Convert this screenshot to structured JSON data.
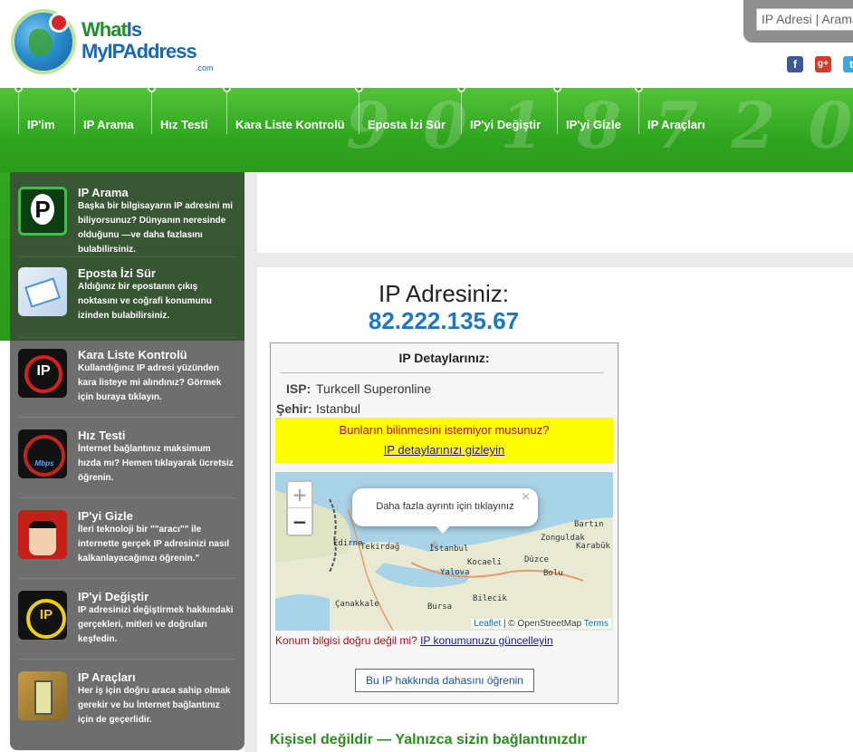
{
  "logo": {
    "line1_a": "What",
    "line1_b": "Is",
    "line2": "MyIPAddress",
    "tld": ".com"
  },
  "search": {
    "placeholder": "IP Adresi | Arama"
  },
  "social": {
    "facebook": "f",
    "googleplus": "g+",
    "twitter": "t"
  },
  "nav": {
    "items": [
      {
        "label": "IP'im"
      },
      {
        "label": "IP Arama"
      },
      {
        "label": "Hız Testi"
      },
      {
        "label": "Kara Liste Kontrolü"
      },
      {
        "label": "Eposta İzi Sür"
      },
      {
        "label": "IP'yi Değiştir"
      },
      {
        "label": "IP'yi Gizle"
      },
      {
        "label": "IP Araçları"
      }
    ]
  },
  "sidebar": {
    "items": [
      {
        "icon": "magnifier-ip-icon",
        "title": "IP Arama",
        "desc": "Başka bir bilgisayarın IP adresini mi biliyorsunuz? Dünyanın neresinde olduğunu —ve daha fazlasını bulabilirsiniz."
      },
      {
        "icon": "email-trace-icon",
        "title": "Eposta İzi Sür",
        "desc": "Aldığınız bir epostanın çıkış noktasını ve coğrafi konumunu izinden bulabilirsiniz."
      },
      {
        "icon": "blacklist-icon",
        "title": "Kara Liste Kontrolü",
        "desc": "Kullandığınız IP adresi yüzünden kara listeye mi alındınız? Görmek için buraya tıklayın."
      },
      {
        "icon": "speedometer-icon",
        "title": "Hız Testi",
        "desc": "İnternet bağlantınız maksimum hızda mı? Hemen tıklayarak ücretsiz öğrenin."
      },
      {
        "icon": "incognito-icon",
        "title": "IP'yi Gizle",
        "desc": "İleri teknoloji bir \"\"aracı\"\" ile internette gerçek IP adresinizi nasıl kalkanlayacağınızı öğrenin.\""
      },
      {
        "icon": "ip-change-icon",
        "title": "IP'yi Değiştir",
        "desc": "IP adresinizi değiştirmek hakkındaki gerçekleri, mitleri ve doğruları keşfedin."
      },
      {
        "icon": "tools-icon",
        "title": "IP Araçları",
        "desc": "Her iş için doğru araca sahip olmak gerekir ve bu İnternet bağlantınız için de geçerlidir."
      }
    ]
  },
  "main": {
    "heading": "IP Adresiniz:",
    "ip": "82.222.135.67",
    "details_title": "IP Detaylarınız:",
    "isp_label": "ISP:",
    "isp_value": "Turkcell Superonline",
    "city_label": "Şehir:",
    "city_value": "Istanbul",
    "hide_question": "Bunların bilinmesini istemiyor musunuz?",
    "hide_link": "IP detaylarınızı gizleyin",
    "map": {
      "zoom_in": "+",
      "zoom_out": "−",
      "popup": "Daha fazla ayrıntı için tıklayınız",
      "popup_close": "×",
      "cities": [
        "Bartın",
        "Zonguldak",
        "Karabük",
        "Edirne",
        "Tekirdağ",
        "İstanbul",
        "Kocaeli",
        "Düzce",
        "Yalova",
        "Bolu",
        "Bilecik",
        "Çanakkale",
        "Bursa"
      ],
      "attribution_leaflet": "Leaflet",
      "attribution_osm": "| © OpenStreetMap",
      "attribution_terms": "Terms"
    },
    "location_question": "Konum bilgisi doğru değil mi?",
    "location_link": "IP konumunuzu güncelleyin",
    "learn_more": "Bu IP hakkında dahasını öğrenin",
    "footer_note": "Kişisel değildir — Yalnızca sizin bağlantınızdır"
  },
  "colors": {
    "nav_green": "#2fa51e",
    "ip_blue": "#1c78c0",
    "highlight_yellow": "#ffff00"
  }
}
